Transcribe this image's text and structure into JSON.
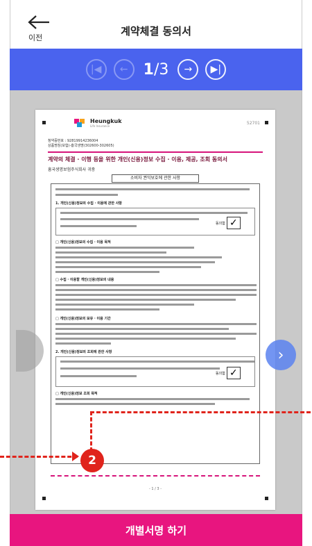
{
  "header": {
    "back_label": "이전",
    "title": "계약체결 동의서"
  },
  "pager": {
    "current": "1",
    "total": "/3"
  },
  "document": {
    "brand": "Heungkuk",
    "brand_sub": "Life Insurance",
    "doc_id": "52701",
    "meta_line1": "청약증번호 : 92819914236004",
    "meta_line2": "상품명칭(보험)-흥국생명(302600-302605)",
    "title": "계약의 체결 · 이행 등을 위한 개인(신용)정보 수집 · 이용, 제공, 조회 동의서",
    "subtitle": "흥국생명보험주식회사 귀중",
    "box_title": "소비자 권익보호에 관한 사항",
    "section1": "1. 개인(신용)정보의 수집 · 이용에 관한 사항",
    "agree_label": "동의함",
    "section2": "□ 개인(신용)정보의 수집 · 이용 목적",
    "section3": "□ 수집 · 이용할 개인(신용)정보의 내용",
    "section4": "□ 개인(신용)정보의 보유 · 이용 기간",
    "section5": "2. 개인(신용)정보의 조회에 관한 사항",
    "section6": "□ 개인(신용)정보 조회 목적",
    "page_footer": "- 1 / 3 -"
  },
  "cta": {
    "label": "개별서명 하기"
  },
  "annotation": {
    "badge": "2"
  },
  "colors": {
    "accent": "#e8157f",
    "pager": "#4a63ee",
    "annotation": "#e0241c"
  }
}
